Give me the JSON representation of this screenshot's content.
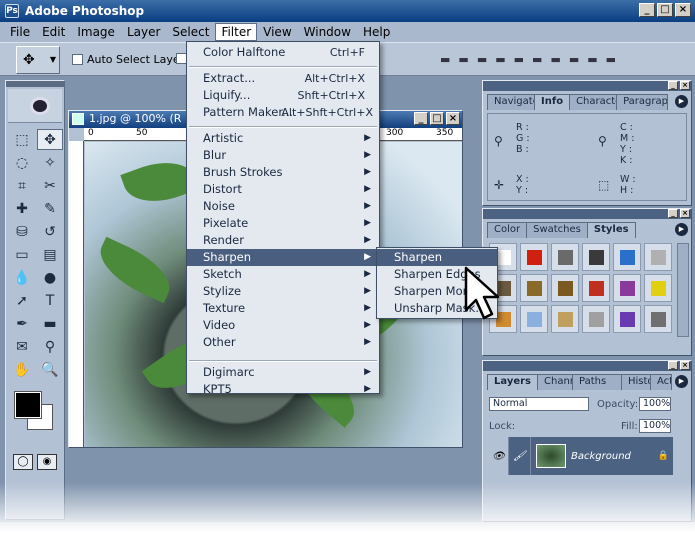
{
  "app": {
    "title": "Adobe Photoshop",
    "logo_glyph": "Ps"
  },
  "window_controls": {
    "min": "_",
    "max": "□",
    "close": "×"
  },
  "menubar": [
    "File",
    "Edit",
    "Image",
    "Layer",
    "Select",
    "Filter",
    "View",
    "Window",
    "Help"
  ],
  "options": {
    "auto_select_layer": "Auto Select Layer",
    "align_glyph": "▬"
  },
  "document": {
    "title": "1.jpg @ 100% (R",
    "ruler_h": [
      "0",
      "50",
      "300",
      "350"
    ]
  },
  "filter_menu": {
    "top": [
      {
        "label": "Color Halftone",
        "shortcut": "Ctrl+F"
      }
    ],
    "group2": [
      {
        "label": "Extract...",
        "shortcut": "Alt+Ctrl+X"
      },
      {
        "label": "Liquify...",
        "shortcut": "Shft+Ctrl+X"
      },
      {
        "label": "Pattern Maker...",
        "shortcut": "Alt+Shft+Ctrl+X"
      }
    ],
    "group3": [
      "Artistic",
      "Blur",
      "Brush Strokes",
      "Distort",
      "Noise",
      "Pixelate",
      "Render",
      "Sharpen",
      "Sketch",
      "Stylize",
      "Texture",
      "Video",
      "Other"
    ],
    "group4": [
      "Digimarc",
      "KPT5"
    ],
    "highlighted": "Sharpen",
    "submenu_arrow": "▶"
  },
  "sharpen_submenu": {
    "items": [
      "Sharpen",
      "Sharpen Edges",
      "Sharpen More",
      "Unsharp Mask..."
    ],
    "highlighted": "Sharpen"
  },
  "info_palette": {
    "tabs": [
      "Navigator",
      "Info",
      "Character",
      "Paragraph"
    ],
    "active": "Info",
    "rgb": [
      "R :",
      "G :",
      "B :"
    ],
    "cmyk": [
      "C :",
      "M :",
      "Y :",
      "K :"
    ],
    "xy": [
      "X :",
      "Y :"
    ],
    "wh": [
      "W :",
      "H :"
    ]
  },
  "styles_palette": {
    "tabs": [
      "Color",
      "Swatches",
      "Styles"
    ],
    "active": "Styles",
    "swatch_colors": [
      "#ffffff",
      "#d02010",
      "#6a6a6a",
      "#3a3a3a",
      "#2a70c8",
      "#b0b0b0",
      "#6b5a40",
      "#8a6a2a",
      "#7a5a20",
      "#c03020",
      "#8a3a9a",
      "#e0d010",
      "#d08a30",
      "#8ab0e0",
      "#c0a060",
      "#a0a0a0",
      "#6a3ab0",
      "#707070"
    ]
  },
  "layers_palette": {
    "tabs": [
      "Layers",
      "Channels",
      "Paths",
      "History",
      "Actions"
    ],
    "active": "Layers",
    "blend_mode": "Normal",
    "opacity_label": "Opacity:",
    "opacity": "100%",
    "lock_label": "Lock:",
    "fill_label": "Fill:",
    "fill": "100%",
    "layer_name": "Background",
    "lock_glyph": "🔒"
  },
  "icon_glyphs": {
    "eye": "👁",
    "brush": "🖌",
    "move": "✥",
    "arrow": "➤",
    "text": "T",
    "marquee": "⬚",
    "lasso": "◌",
    "wand": "✧",
    "crop": "⌗",
    "slice": "✂",
    "heal": "✚",
    "pencil": "✎",
    "stamp": "⛁",
    "history_brush": "↺",
    "eraser": "▭",
    "gradient": "▤",
    "blur": "💧",
    "dodge": "●",
    "path": "➚",
    "pen": "✒",
    "shape": "▬",
    "notes": "✉",
    "eyedropper": "⚲",
    "hand": "✋",
    "zoom": "🔍",
    "standard": "◯",
    "quickmask": "◉"
  }
}
